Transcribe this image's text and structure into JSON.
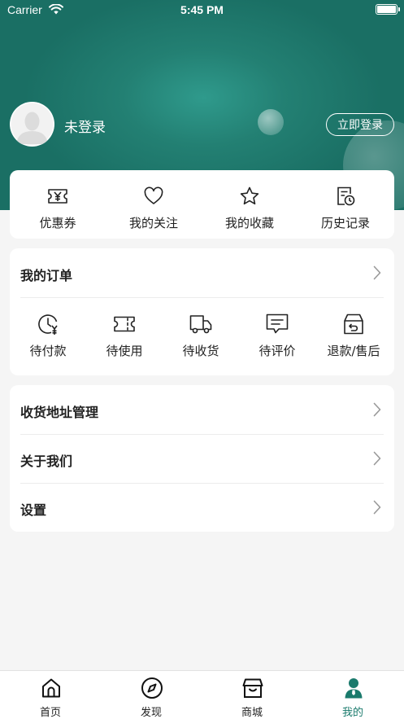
{
  "status_bar": {
    "carrier": "Carrier",
    "time": "5:45 PM"
  },
  "profile": {
    "name": "未登录",
    "login_label": "立即登录"
  },
  "quick_links": [
    {
      "label": "优惠券",
      "icon": "coupon-icon"
    },
    {
      "label": "我的关注",
      "icon": "heart-icon"
    },
    {
      "label": "我的收藏",
      "icon": "star-icon"
    },
    {
      "label": "历史记录",
      "icon": "history-icon"
    }
  ],
  "orders": {
    "title": "我的订单",
    "items": [
      {
        "label": "待付款",
        "icon": "pending-payment-icon"
      },
      {
        "label": "待使用",
        "icon": "ticket-icon"
      },
      {
        "label": "待收货",
        "icon": "truck-icon"
      },
      {
        "label": "待评价",
        "icon": "comment-icon"
      },
      {
        "label": "退款/售后",
        "icon": "refund-icon"
      }
    ]
  },
  "menu": [
    {
      "label": "收货地址管理"
    },
    {
      "label": "关于我们"
    },
    {
      "label": "设置"
    }
  ],
  "tabbar": {
    "tabs": [
      {
        "label": "首页",
        "icon": "home-icon"
      },
      {
        "label": "发现",
        "icon": "compass-icon"
      },
      {
        "label": "商城",
        "icon": "store-icon"
      },
      {
        "label": "我的",
        "icon": "user-icon"
      }
    ],
    "active_index": 3,
    "active_color": "#1a7a6c"
  },
  "colors": {
    "brand": "#1f7a6e",
    "background": "#f5f5f5"
  }
}
